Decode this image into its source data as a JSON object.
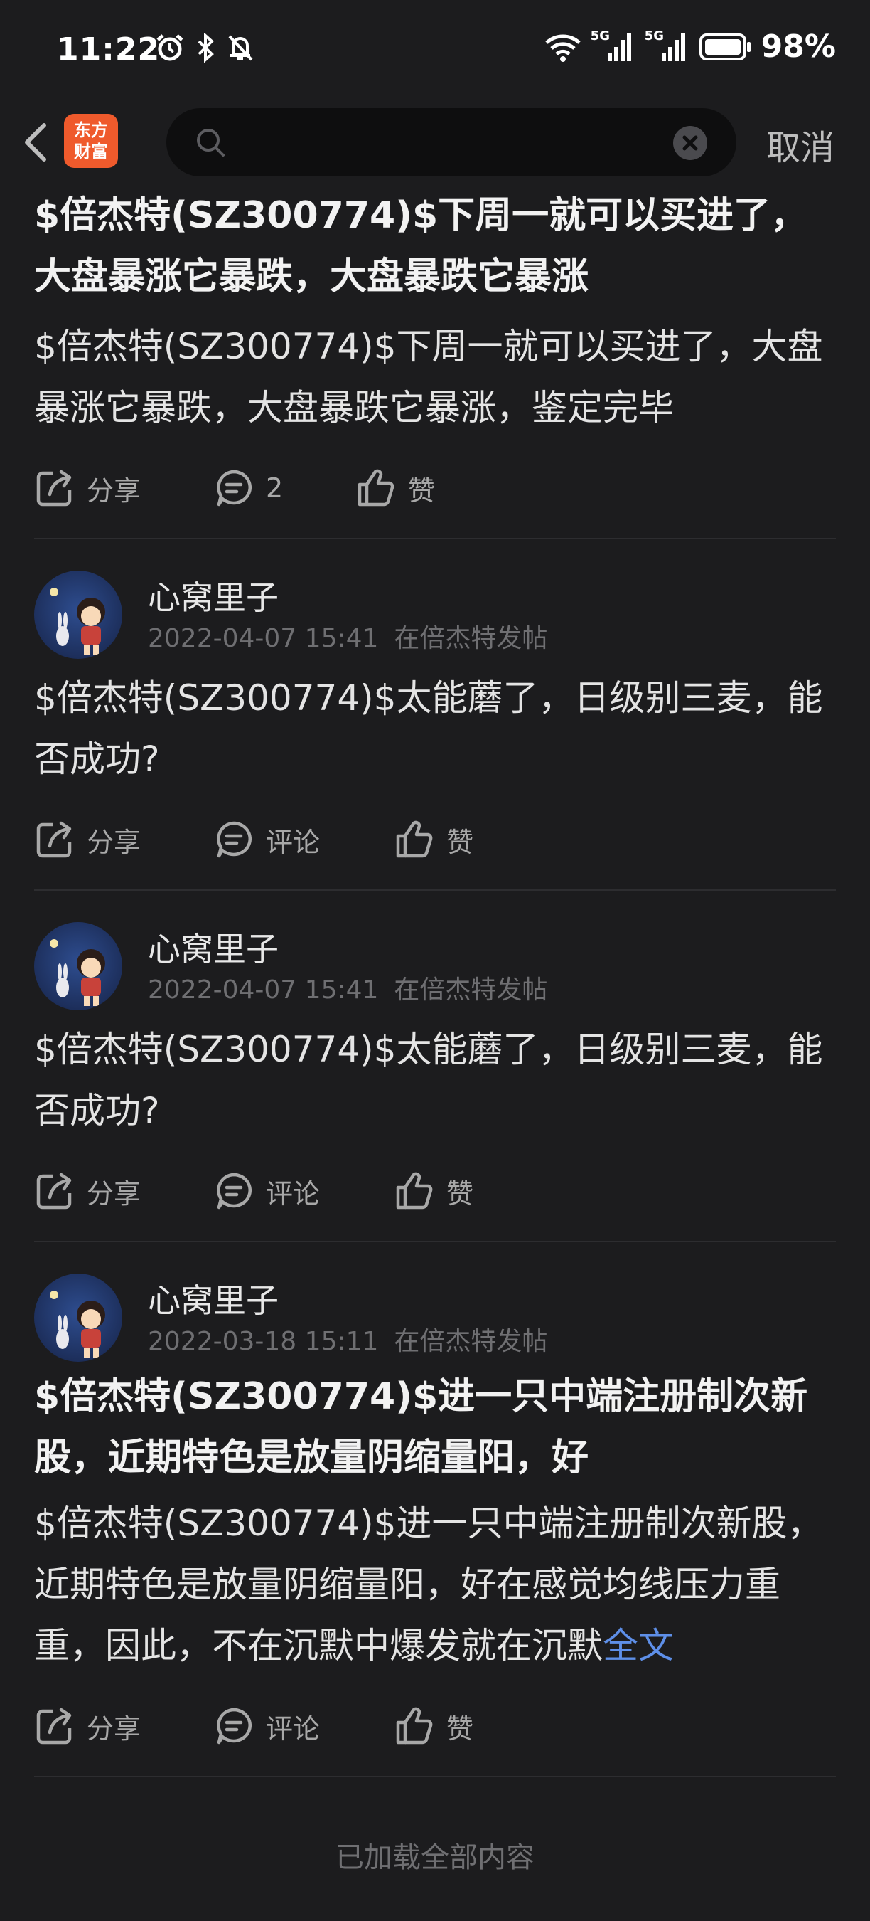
{
  "status_bar": {
    "time": "11:22",
    "network1": "5G",
    "network2": "5G",
    "battery": "98%"
  },
  "topbar": {
    "logo_line1": "东方",
    "logo_line2": "财富",
    "search_value": "",
    "cancel_label": "取消"
  },
  "posts": [
    {
      "title": "$倍杰特(SZ300774)$下周一就可以买进了，大盘暴涨它暴跌，大盘暴跌它暴涨",
      "body": "$倍杰特(SZ300774)$下周一就可以买进了，大盘暴涨它暴跌，大盘暴跌它暴涨，鉴定完毕",
      "share": "分享",
      "comment": "2",
      "like": "赞"
    },
    {
      "author": "心窝里子",
      "date": "2022-04-07 15:41",
      "where": "在倍杰特发帖",
      "body": "$倍杰特(SZ300774)$太能蘑了，日级别三麦，能否成功?",
      "share": "分享",
      "comment": "评论",
      "like": "赞"
    },
    {
      "author": "心窝里子",
      "date": "2022-04-07 15:41",
      "where": "在倍杰特发帖",
      "body": "$倍杰特(SZ300774)$太能蘑了，日级别三麦，能否成功?",
      "share": "分享",
      "comment": "评论",
      "like": "赞"
    },
    {
      "author": "心窝里子",
      "date": "2022-03-18 15:11",
      "where": "在倍杰特发帖",
      "title": "$倍杰特(SZ300774)$进一只中端注册制次新股，近期特色是放量阴缩量阳，好",
      "body": "$倍杰特(SZ300774)$进一只中端注册制次新股，近期特色是放量阴缩量阳，好在感觉均线压力重重，因此，不在沉默中爆发就在沉默",
      "more": "全文",
      "share": "分享",
      "comment": "评论",
      "like": "赞"
    }
  ],
  "footer": "已加载全部内容",
  "colors": {
    "background": "#1c1c1e",
    "accent_link": "#5e8fe8",
    "logo_bg": "#ef5a2c"
  }
}
